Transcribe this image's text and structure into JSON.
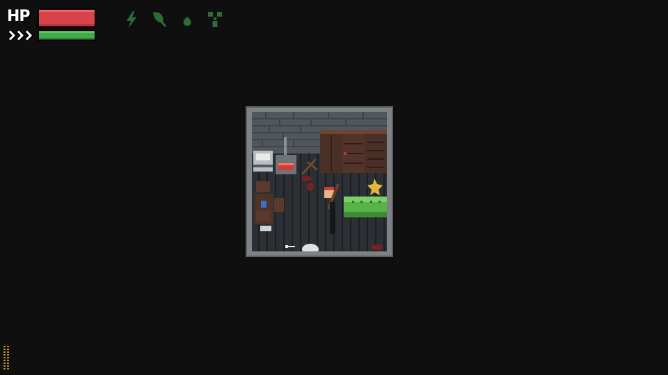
{
  "hud": {
    "hp_label": "HP",
    "hp_level": 1.0,
    "stamina_level": 1.0,
    "sprint_icon": "triple-chevron-icon",
    "status_icons": [
      "lightning-icon",
      "leaf-icon",
      "drop-icon",
      "radiation-icon"
    ],
    "colors": {
      "hp": "#d9444a",
      "stamina": "#3fae4a",
      "status_icons": "#2f6b36"
    }
  },
  "scene": {
    "objects": [
      "stone-wall",
      "wood-stove",
      "kitchen-cabinet",
      "wooden-wardrobes",
      "green-couch",
      "table",
      "chairs",
      "blue-bottle",
      "player-with-rifle",
      "blood-stains",
      "lit-candle"
    ]
  }
}
